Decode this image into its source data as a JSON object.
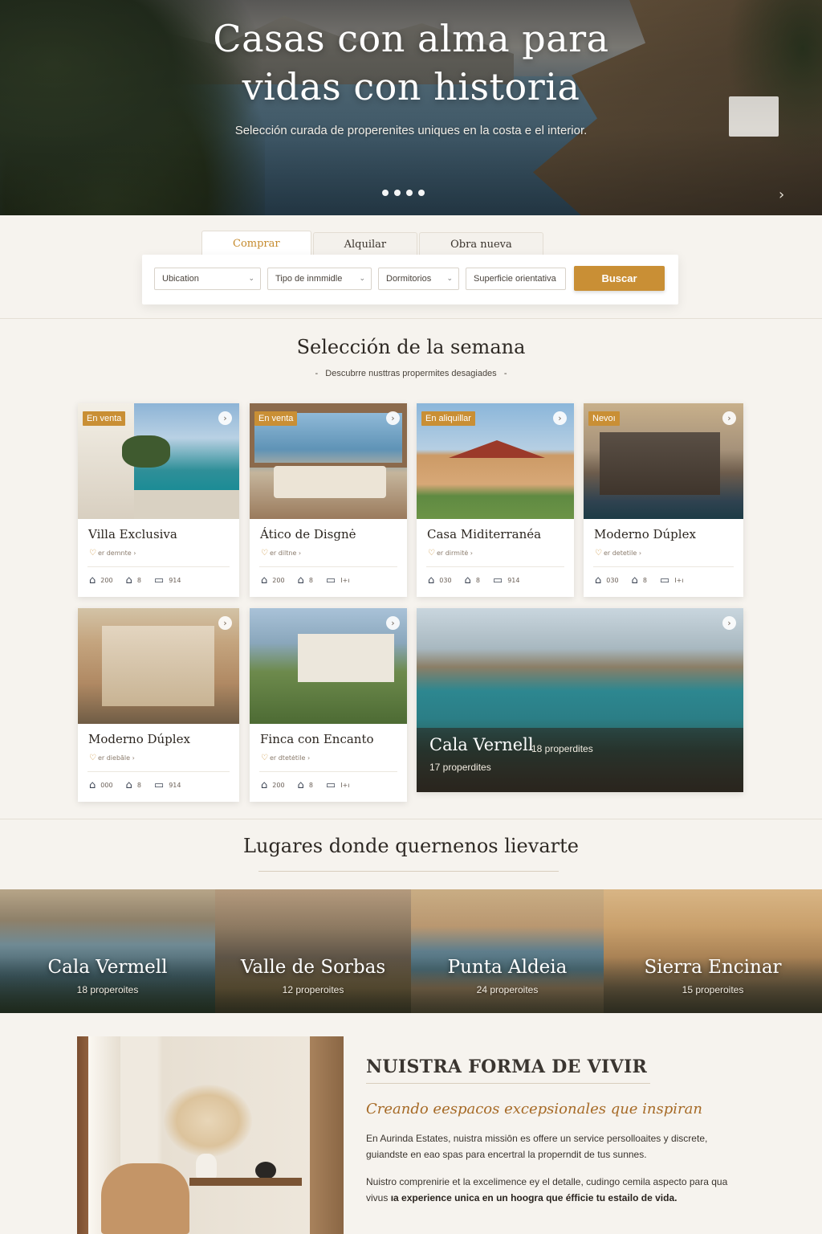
{
  "hero": {
    "title_line1": "Casas con alma para",
    "title_line2": "vidas con historia",
    "subtitle": "Selección curada de properenites uniques en la costa e el interior.",
    "next_icon": "›"
  },
  "search": {
    "tabs": [
      "Comprar",
      "Alquilar",
      "Obra nueva"
    ],
    "active_tab": "Comprar",
    "fields": [
      "Ubication",
      "Tipo de inmmidle",
      "Dormitorios",
      "Superficie orientativa"
    ],
    "button": "Buscar",
    "accent": "#c98f35"
  },
  "featured": {
    "title": "Selección de la semana",
    "subtitle": "Descubrre nusttras propermites desagiades",
    "cards": [
      {
        "badge": "En venta",
        "name": "Villa Exclusiva",
        "loc": "er demnte",
        "f1": "200",
        "f2": "8",
        "f3": "914"
      },
      {
        "badge": "En venta",
        "name": "Ático de Disgnė",
        "loc": "er diltne",
        "f1": "200",
        "f2": "8",
        "f3": "I+ı"
      },
      {
        "badge": "En aliquillar",
        "name": "Casa Miditerranéa",
        "loc": "er dirmitė",
        "f1": "030",
        "f2": "8",
        "f3": "914"
      },
      {
        "badge": "Nevoı",
        "name": "Moderno Dúplex",
        "loc": "er detetile",
        "f1": "030",
        "f2": "8",
        "f3": "I+ı"
      },
      {
        "badge": "",
        "name": "Moderno Dúplex",
        "loc": "er diebāle",
        "f1": "000",
        "f2": "8",
        "f3": "914"
      },
      {
        "badge": "",
        "name": "Finca con Encanto",
        "loc": "er dtetėtile",
        "f1": "200",
        "f2": "8",
        "f3": "I+ı"
      }
    ],
    "feature_card": {
      "title": "Cala Vernell",
      "count_inline": "18 properdites",
      "count_below": "17 properdites"
    }
  },
  "places": {
    "title": "Lugares donde quernenos lievarte",
    "items": [
      {
        "name": "Cala Vermell",
        "count": "18 properoites"
      },
      {
        "name": "Valle de Sorbas",
        "count": "12 properoites"
      },
      {
        "name": "Punta Aldeia",
        "count": "24 properoites"
      },
      {
        "name": "Sierra Encinar",
        "count": "15 properoites"
      }
    ]
  },
  "about": {
    "heading": "NUISTRA FORMA DE VIVIR",
    "subheading": "Creando eespacos excepsionales que inspiran",
    "p1": "En Aurinda Estates, nuistra missiōn es offere un service persolloaites y discrete, guiandste en eao spas para encertral la properndit de tus sunnes.",
    "p2_plain": "Nuistro comprenirie et la excelimence ey el detalle, cudingo cemila aspecto para qua vivus ",
    "p2_bold": "ıa experience unica en un hoogra que éfficie tu estailo de vida."
  }
}
